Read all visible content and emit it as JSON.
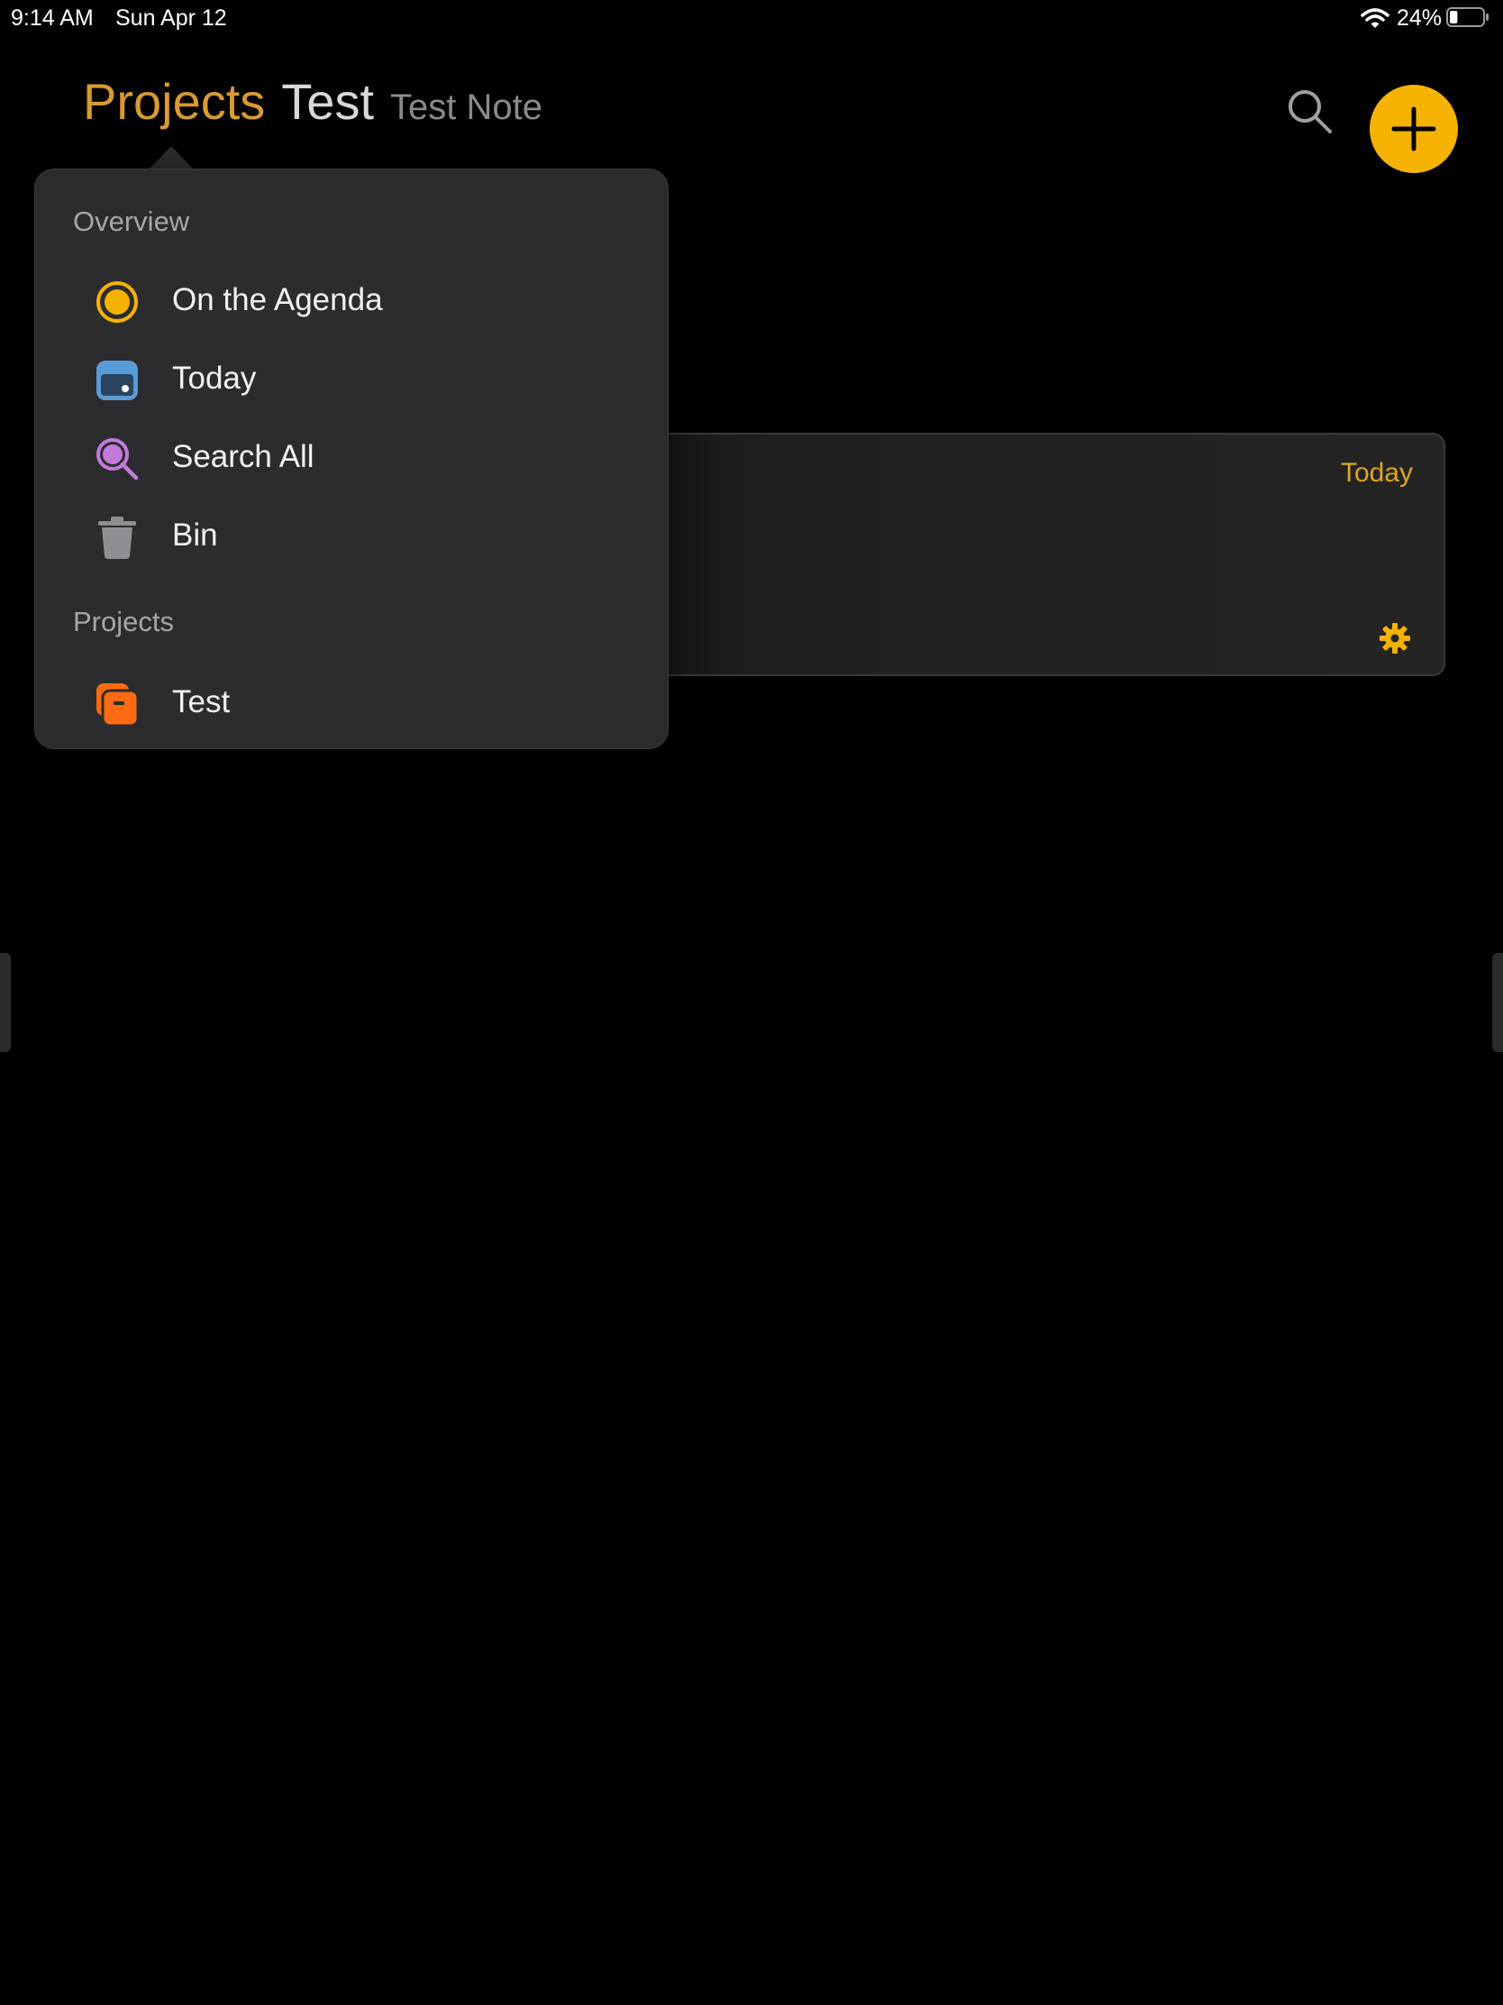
{
  "status_bar": {
    "time": "9:14 AM",
    "date": "Sun Apr 12",
    "battery": "24%",
    "battery_level": 0.24
  },
  "header": {
    "crumb_projects": "Projects",
    "crumb_project": "Test",
    "crumb_note": "Test Note"
  },
  "note_card": {
    "date": "Today"
  },
  "popover": {
    "overview_title": "Overview",
    "overview_items": [
      {
        "label": "On the Agenda",
        "icon": "agenda-icon",
        "color": "#f5b300"
      },
      {
        "label": "Today",
        "icon": "calendar-icon",
        "color": "#5b9bd5"
      },
      {
        "label": "Search All",
        "icon": "search-all-icon",
        "color": "#c27bd9"
      },
      {
        "label": "Bin",
        "icon": "trash-icon",
        "color": "#8e8e93"
      }
    ],
    "projects_title": "Projects",
    "project_items": [
      {
        "label": "Test",
        "icon": "project-icon",
        "color": "#ff6a13"
      }
    ]
  },
  "colors": {
    "accent": "#f5b300",
    "crumb_accent": "#d99a32",
    "background": "#000000"
  }
}
